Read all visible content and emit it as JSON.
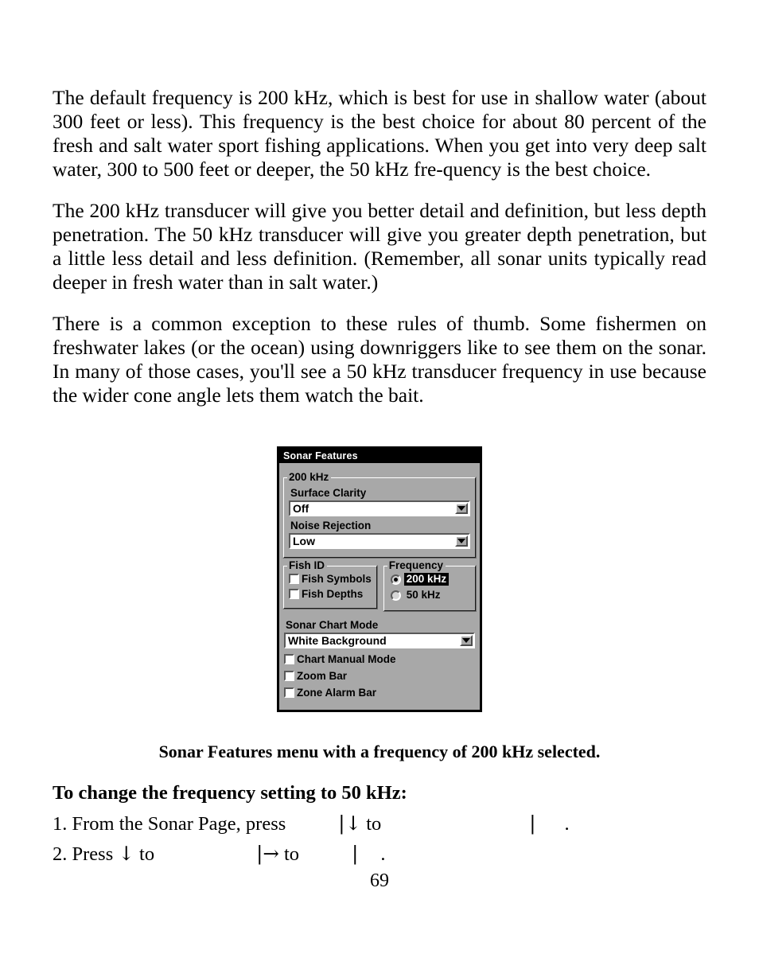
{
  "document": {
    "page_number": "69",
    "paragraphs": [
      "The default frequency is 200 kHz, which is best for use in shallow water (about 300 feet or less). This frequency is the best choice for about 80 percent of the fresh and salt water sport fishing applications. When you get into very deep salt water, 300 to 500 feet or deeper, the 50 kHz fre-quency is the best choice.",
      "The 200 kHz transducer will give you better detail and definition, but less depth penetration. The 50 kHz transducer will give you greater depth penetration, but a little less detail and less definition. (Remember, all sonar units typically read deeper in fresh water than in salt water.)",
      "There is a common exception to these rules of thumb. Some fishermen on freshwater lakes (or the ocean) using downriggers like to see them on the sonar. In many of those cases, you'll see a 50 kHz transducer frequency in use because the wider cone angle lets them watch the bait."
    ],
    "figure_caption": "Sonar Features menu with a frequency of 200 kHz selected.",
    "steps_heading": "To change the frequency setting to 50 kHz:",
    "steps": [
      {
        "number": "1.",
        "text_a": "From the Sonar Page, press",
        "pipe": "|",
        "arrow": "↓",
        "text_b": "to",
        "pipe2": "|",
        "period": "."
      },
      {
        "number": "2.",
        "text_a": "Press",
        "arrow_a": "↓",
        "text_b": "to",
        "pipe": "|",
        "arrow_b": "→",
        "text_c": "to",
        "pipe2": "|",
        "period": "."
      }
    ]
  },
  "dialog": {
    "title": "Sonar Features",
    "group_200khz": {
      "legend": "200 kHz",
      "surface_clarity": {
        "label": "Surface Clarity",
        "value": "Off"
      },
      "noise_rejection": {
        "label": "Noise Rejection",
        "value": "Low"
      }
    },
    "fish_id": {
      "legend": "Fish ID",
      "options": [
        {
          "label": "Fish Symbols",
          "checked": false
        },
        {
          "label": "Fish Depths",
          "checked": false
        }
      ]
    },
    "frequency": {
      "legend": "Frequency",
      "options": [
        {
          "label": "200 kHz",
          "selected": true
        },
        {
          "label": "50 kHz",
          "selected": false
        }
      ]
    },
    "sonar_chart_mode": {
      "label": "Sonar Chart Mode",
      "value": "White Background"
    },
    "bottom_options": [
      {
        "label": "Chart Manual Mode",
        "checked": false
      },
      {
        "label": "Zoom Bar",
        "checked": false
      },
      {
        "label": "Zone Alarm Bar",
        "checked": false
      }
    ],
    "colors": {
      "background": "#a8a8a8",
      "titlebar_bg": "#000000",
      "titlebar_fg": "#ffffff",
      "field_bg": "#ffffff",
      "selected_bg": "#000000",
      "selected_fg": "#ffffff"
    }
  }
}
